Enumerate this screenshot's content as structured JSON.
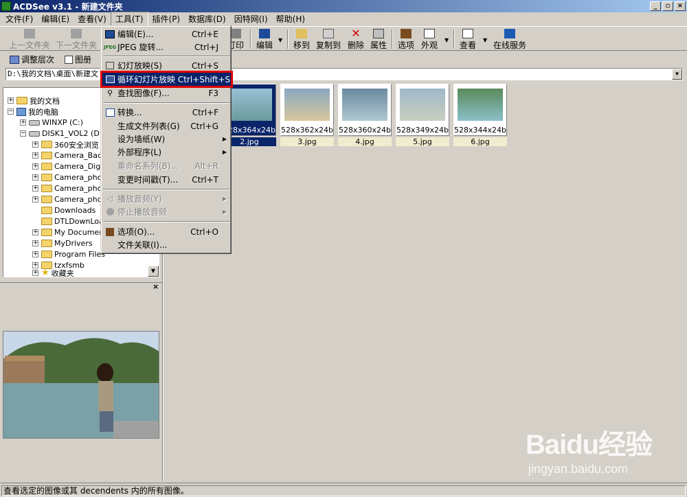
{
  "window": {
    "title": "ACDSee v3.1 - 新建文件夹"
  },
  "menubar": [
    "文件(F)",
    "编辑(E)",
    "查看(V)",
    "工具(T)",
    "插件(P)",
    "数据库(D)",
    "因特网(I)",
    "帮助(H)"
  ],
  "toolbar": {
    "up": "上一文件夹",
    "next": "下一文件夹",
    "print": "打印",
    "edit": "编辑",
    "move": "移到",
    "copy": "复制到",
    "delete": "删除",
    "props": "属性",
    "options": "选项",
    "appearance": "外观",
    "view": "查看",
    "online": "在线服务"
  },
  "toolbar2": {
    "adjust": "调整层次",
    "gallery": "图册"
  },
  "address": {
    "path": "D:\\我的文档\\桌面\\新建文"
  },
  "tree": {
    "items": [
      "我的文档",
      "我的电脑",
      "WINXP (C:)",
      "DISK1_VOL2 (D:)",
      "360安全浏览",
      "Camera_Back",
      "Camera_Digit",
      "Camera_phot",
      "Camera_phot",
      "Camera_phot",
      "Downloads",
      "DTLDownLoad",
      "My Documents",
      "MyDrivers",
      "Program Files",
      "tzxfsmb",
      "收藏夹"
    ]
  },
  "thumbnails": [
    {
      "dims": "528x364x24b",
      "name": "2.jpg",
      "selected": true
    },
    {
      "dims": "528x362x24b",
      "name": "3.jpg"
    },
    {
      "dims": "528x360x24b",
      "name": "4.jpg"
    },
    {
      "dims": "528x349x24b",
      "name": "5.jpg"
    },
    {
      "dims": "528x344x24b",
      "name": "6.jpg"
    }
  ],
  "tools_menu": {
    "edit": {
      "label": "编辑(E)...",
      "shortcut": "Ctrl+E"
    },
    "jpeg_rotate": {
      "label": "JPEG 旋转...",
      "shortcut": "Ctrl+J"
    },
    "slideshow": {
      "label": "幻灯放映(S)",
      "shortcut": "Ctrl+S"
    },
    "loop_slideshow": {
      "label": "循环幻灯片放映 Ctrl+Shift+S"
    },
    "find_images": {
      "label": "查找图像(F)...",
      "shortcut": "F3"
    },
    "convert": {
      "label": "转换...",
      "shortcut": "Ctrl+F"
    },
    "gen_list": {
      "label": "生成文件列表(G)",
      "shortcut": "Ctrl+G"
    },
    "wallpaper": {
      "label": "设为墙纸(W)"
    },
    "external": {
      "label": "外部程序(L)"
    },
    "rename_series": {
      "label": "重命名系列(B)...",
      "shortcut": "Alt+R"
    },
    "change_timestamp": {
      "label": "变更时间戳(T)...",
      "shortcut": "Ctrl+T"
    },
    "play_audio": {
      "label": "播放音频(Y)"
    },
    "stop_audio": {
      "label": "停止播放音频"
    },
    "options": {
      "label": "选项(O)...",
      "shortcut": "Ctrl+O"
    },
    "file_assoc": {
      "label": "文件关联(I)..."
    }
  },
  "status": {
    "text": "查看选定的图像或其 decendents 内的所有图像。"
  },
  "watermark": {
    "logo": "Baidu经验",
    "url": "jingyan.baidu.com"
  }
}
